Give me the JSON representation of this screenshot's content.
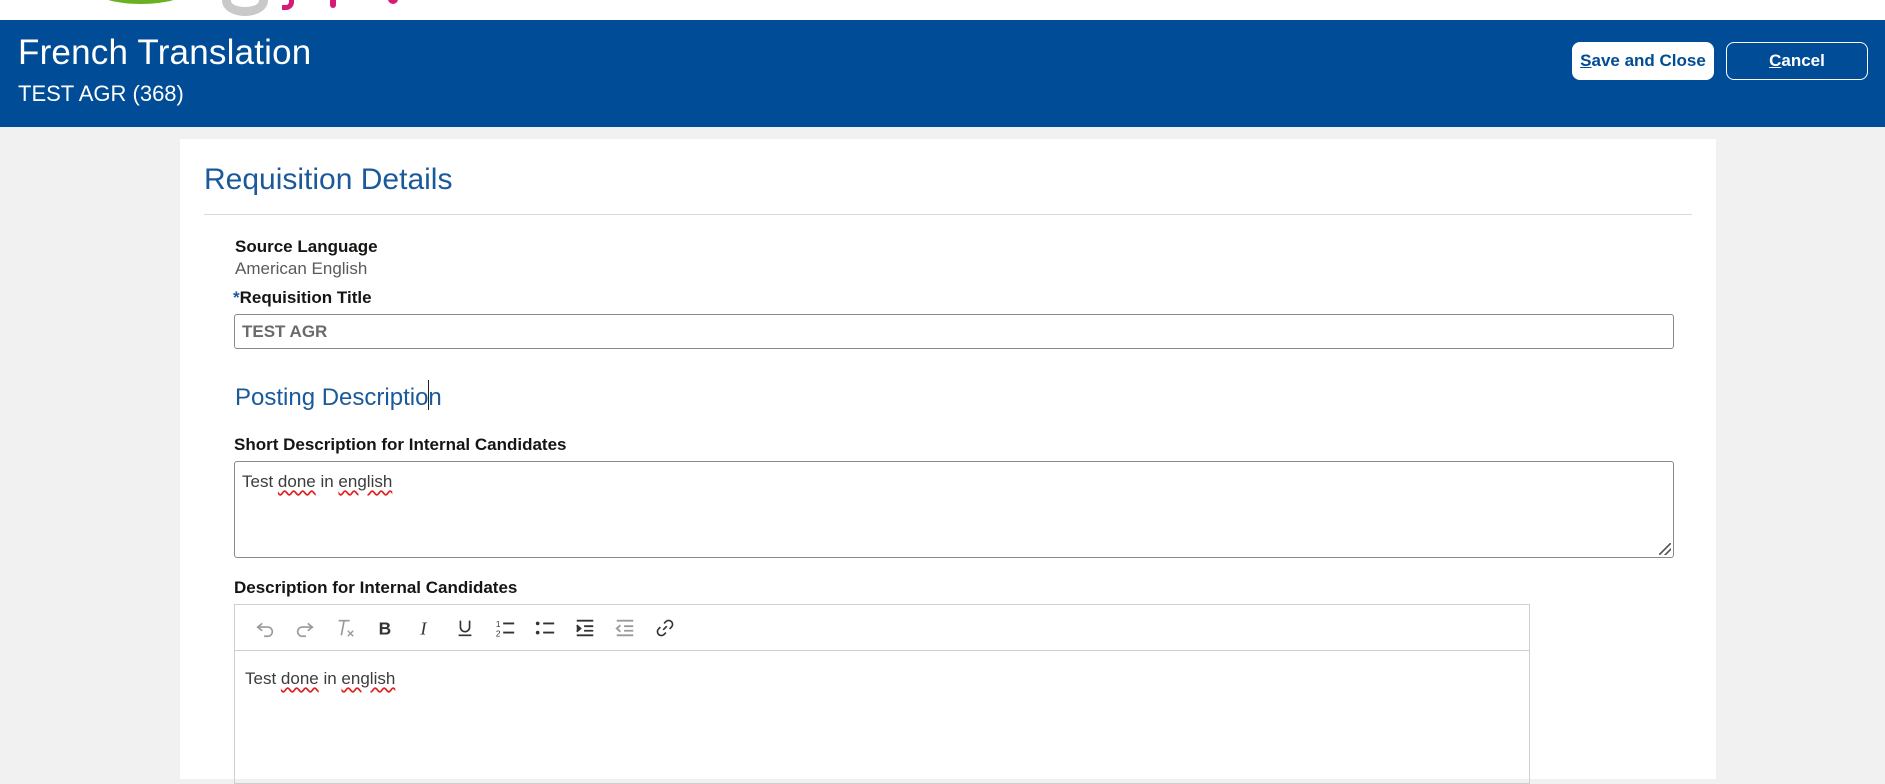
{
  "header": {
    "title": "French Translation",
    "subtitle": "TEST AGR (368)",
    "save_label": "Save and Close",
    "save_access_key": "S",
    "save_rest": "ave and Close",
    "cancel_access_key": "C",
    "cancel_rest": "ancel"
  },
  "section": {
    "title": "Requisition Details"
  },
  "source_language": {
    "label": "Source Language",
    "value": "American English"
  },
  "requisition_title": {
    "required_mark": "*",
    "label": "Requisition Title",
    "value": "TEST AGR"
  },
  "posting": {
    "title": "Posting Description"
  },
  "short_description": {
    "label": "Short Description for Internal Candidates",
    "value_parts": [
      "Test ",
      "done",
      " in ",
      "english"
    ]
  },
  "description": {
    "label": "Description for Internal Candidates",
    "value_parts": [
      "Test ",
      "done",
      " in ",
      "english"
    ],
    "toolbar": [
      {
        "name": "undo-icon",
        "icon": "undo"
      },
      {
        "name": "redo-icon",
        "icon": "redo"
      },
      {
        "name": "clear-formatting-icon",
        "icon": "clear-formatting"
      },
      {
        "name": "bold-icon",
        "icon": "bold"
      },
      {
        "name": "italic-icon",
        "icon": "italic"
      },
      {
        "name": "underline-icon",
        "icon": "underline"
      },
      {
        "name": "numbered-list-icon",
        "icon": "numbered-list"
      },
      {
        "name": "bulleted-list-icon",
        "icon": "bulleted-list"
      },
      {
        "name": "indent-icon",
        "icon": "indent"
      },
      {
        "name": "outdent-icon",
        "icon": "outdent"
      },
      {
        "name": "link-icon",
        "icon": "link"
      }
    ]
  },
  "colors": {
    "header_bg": "#004c97",
    "accent_text": "#1b5a9a",
    "page_bg": "#f1f1f1"
  }
}
